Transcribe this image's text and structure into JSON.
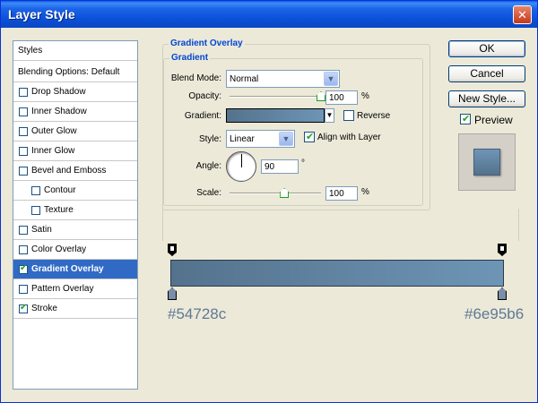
{
  "window": {
    "title": "Layer Style",
    "close_glyph": "✕"
  },
  "styles_list": {
    "header": "Styles",
    "blending": "Blending Options: Default",
    "items": [
      {
        "label": "Drop Shadow",
        "checked": false,
        "indent": false
      },
      {
        "label": "Inner Shadow",
        "checked": false,
        "indent": false
      },
      {
        "label": "Outer Glow",
        "checked": false,
        "indent": false
      },
      {
        "label": "Inner Glow",
        "checked": false,
        "indent": false
      },
      {
        "label": "Bevel and Emboss",
        "checked": false,
        "indent": false
      },
      {
        "label": "Contour",
        "checked": false,
        "indent": true
      },
      {
        "label": "Texture",
        "checked": false,
        "indent": true
      },
      {
        "label": "Satin",
        "checked": false,
        "indent": false
      },
      {
        "label": "Color Overlay",
        "checked": false,
        "indent": false
      },
      {
        "label": "Gradient Overlay",
        "checked": true,
        "indent": false,
        "selected": true
      },
      {
        "label": "Pattern Overlay",
        "checked": false,
        "indent": false
      },
      {
        "label": "Stroke",
        "checked": true,
        "indent": false
      }
    ]
  },
  "panel": {
    "outer_title": "Gradient Overlay",
    "inner_title": "Gradient",
    "blend_mode": {
      "label": "Blend Mode:",
      "value": "Normal"
    },
    "opacity": {
      "label": "Opacity:",
      "value": "100",
      "unit": "%",
      "level": 1.0
    },
    "gradient": {
      "label": "Gradient:",
      "reverse_label": "Reverse",
      "reverse_checked": false
    },
    "style": {
      "label": "Style:",
      "value": "Linear",
      "align_label": "Align with Layer",
      "align_checked": true
    },
    "angle": {
      "label": "Angle:",
      "value": "90",
      "unit": "°"
    },
    "scale": {
      "label": "Scale:",
      "value": "100",
      "unit": "%",
      "level": 0.6
    }
  },
  "buttons": {
    "ok": "OK",
    "cancel": "Cancel",
    "new_style": "New Style...",
    "preview_label": "Preview",
    "preview_checked": true
  },
  "editor": {
    "start_color": "#54728c",
    "end_color": "#6e95b6"
  },
  "colors": {
    "gradient_start": "#54728c",
    "gradient_end": "#6e95b6",
    "selected": "#316ac5",
    "accent": "#0046d5"
  },
  "icons": {
    "dropdown": "chevron-down-icon",
    "close": "close-icon",
    "check": "check-icon"
  }
}
